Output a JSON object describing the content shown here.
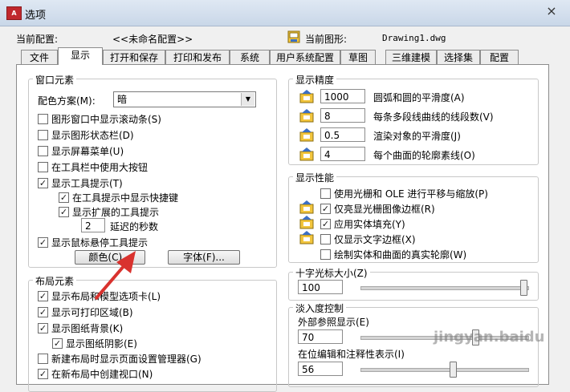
{
  "window": {
    "title": "选项",
    "app_icon_text": "A",
    "close_glyph": "×"
  },
  "profile": {
    "current_profile_label": "当前配置:",
    "current_profile_value": "<<未命名配置>>",
    "current_drawing_label": "当前图形:",
    "current_drawing_value": "Drawing1.dwg"
  },
  "tabs": [
    {
      "label": "文件"
    },
    {
      "label": "显示"
    },
    {
      "label": "打开和保存"
    },
    {
      "label": "打印和发布"
    },
    {
      "label": "系统"
    },
    {
      "label": "用户系统配置"
    },
    {
      "label": "草图"
    },
    {
      "label": "三维建模"
    },
    {
      "label": "选择集"
    },
    {
      "label": "配置"
    }
  ],
  "window_elements": {
    "legend": "窗口元素",
    "color_scheme_label": "配色方案(M):",
    "color_scheme_value": "暗",
    "items": [
      {
        "label": "图形窗口中显示滚动条(S)",
        "checked": false
      },
      {
        "label": "显示图形状态栏(D)",
        "checked": false
      },
      {
        "label": "显示屏幕菜单(U)",
        "checked": false
      },
      {
        "label": "在工具栏中使用大按钮",
        "checked": false
      },
      {
        "label": "显示工具提示(T)",
        "checked": true
      },
      {
        "label": "在工具提示中显示快捷键",
        "checked": true
      },
      {
        "label": "显示扩展的工具提示",
        "checked": true
      },
      {
        "label": "显示鼠标悬停工具提示",
        "checked": true
      }
    ],
    "delay_value": "2",
    "delay_label": "延迟的秒数",
    "colors_button": "颜色(C)...",
    "fonts_button": "字体(F)..."
  },
  "layout_elements": {
    "legend": "布局元素",
    "items": [
      {
        "label": "显示布局和模型选项卡(L)",
        "checked": true
      },
      {
        "label": "显示可打印区域(B)",
        "checked": true
      },
      {
        "label": "显示图纸背景(K)",
        "checked": true
      },
      {
        "label": "显示图纸阴影(E)",
        "checked": true
      },
      {
        "label": "新建布局时显示页面设置管理器(G)",
        "checked": false
      },
      {
        "label": "在新布局中创建视口(N)",
        "checked": true
      }
    ]
  },
  "display_resolution": {
    "legend": "显示精度",
    "items": [
      {
        "value": "1000",
        "label": "圆弧和圆的平滑度(A)"
      },
      {
        "value": "8",
        "label": "每条多段线曲线的线段数(V)"
      },
      {
        "value": "0.5",
        "label": "渲染对象的平滑度(J)"
      },
      {
        "value": "4",
        "label": "每个曲面的轮廓素线(O)"
      }
    ]
  },
  "display_performance": {
    "legend": "显示性能",
    "items": [
      {
        "label": "使用光栅和 OLE 进行平移与缩放(P)",
        "checked": false
      },
      {
        "label": "仅亮显光栅图像边框(R)",
        "checked": true
      },
      {
        "label": "应用实体填充(Y)",
        "checked": true
      },
      {
        "label": "仅显示文字边框(X)",
        "checked": false
      },
      {
        "label": "绘制实体和曲面的真实轮廓(W)",
        "checked": false
      }
    ]
  },
  "crosshair": {
    "legend": "十字光标大小(Z)",
    "value": "100",
    "level": 100
  },
  "fade": {
    "legend": "淡入度控制",
    "xref_label": "外部参照显示(E)",
    "xref_value": "70",
    "xref_level": 70,
    "inplace_label": "在位编辑和注释性表示(I)",
    "inplace_value": "56",
    "inplace_level": 56
  },
  "watermark": "jingyan.baidu",
  "colors": {
    "accent_red": "#d9322e",
    "checkmark": "#1a1a1a"
  }
}
